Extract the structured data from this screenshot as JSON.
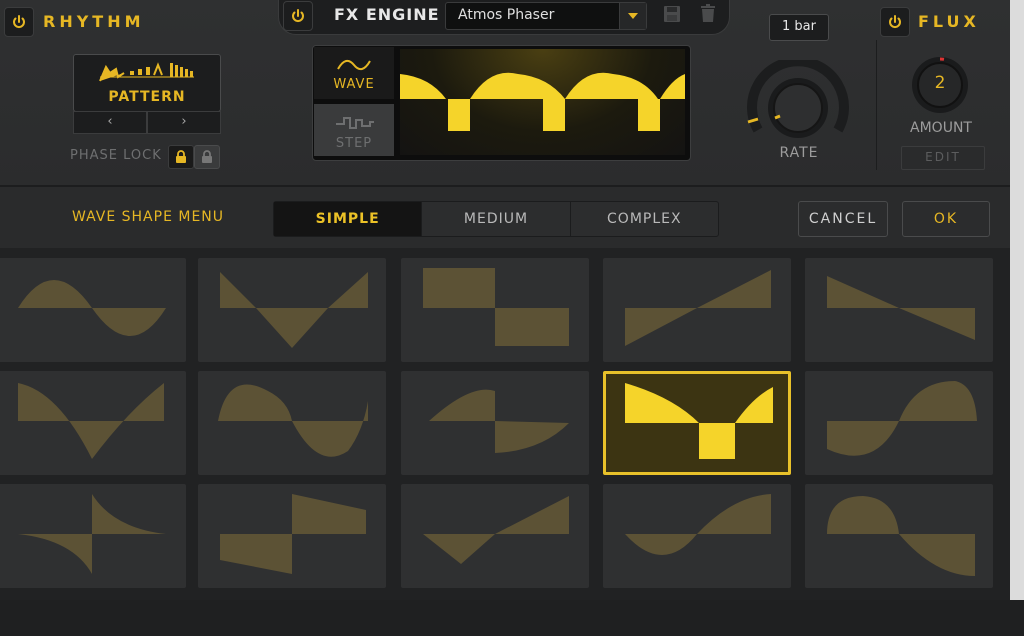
{
  "rhythm": {
    "title": "RHYTHM",
    "pattern_label": "PATTERN",
    "prev_symbol": "‹",
    "next_symbol": "›",
    "phase_lock_label": "PHASE LOCK"
  },
  "fx_engine": {
    "title": "FX ENGINE",
    "selected_effect": "Atmos Phaser"
  },
  "display": {
    "wave_tab_label": "WAVE",
    "step_tab_label": "STEP",
    "active_tab": "WAVE"
  },
  "rate": {
    "value": "1 bar",
    "label": "RATE"
  },
  "flux": {
    "title": "FLUX",
    "amount_value": "2",
    "amount_label": "AMOUNT",
    "edit_label": "EDIT"
  },
  "wave_shape_menu": {
    "label": "WAVE SHAPE MENU",
    "tabs": [
      "SIMPLE",
      "MEDIUM",
      "COMPLEX"
    ],
    "active_tab": "SIMPLE",
    "cancel_label": "CANCEL",
    "ok_label": "OK",
    "selected_shape_row": 2,
    "selected_shape_col": 4
  },
  "colors": {
    "accent": "#e6b724",
    "shape_fill": "#5c5235",
    "shape_selected_fill": "#f5d42a"
  },
  "icons": [
    "power-icon",
    "save-icon",
    "trash-icon",
    "chevron-down-icon",
    "lock-icon",
    "unlock-icon",
    "wave-icon",
    "step-icon",
    "pattern-icon"
  ]
}
